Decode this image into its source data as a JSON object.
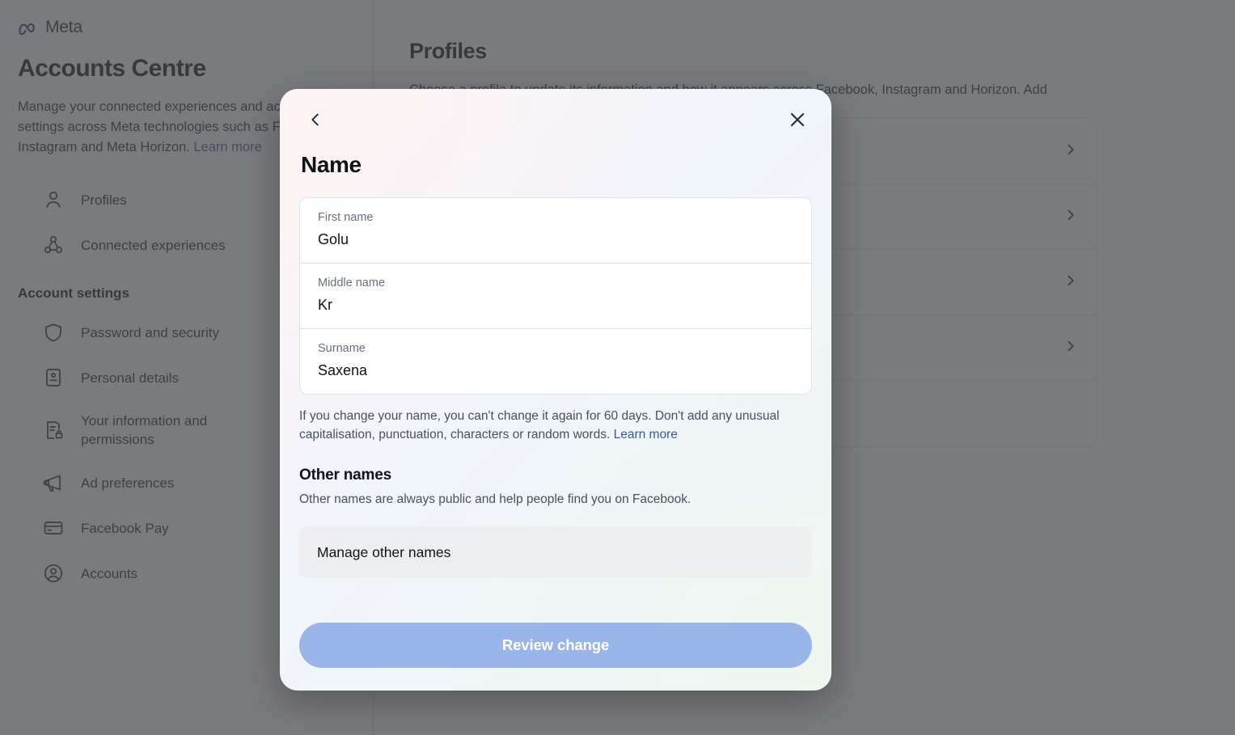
{
  "brand": {
    "name": "Meta",
    "logo_icon": "meta-infinity-icon"
  },
  "sidebar": {
    "title": "Accounts Centre",
    "description": "Manage your connected experiences and account settings across Meta technologies such as Facebook, Instagram and Meta Horizon.",
    "learn_more": "Learn more",
    "primary_items": [
      {
        "label": "Profiles",
        "icon": "person-icon"
      },
      {
        "label": "Connected experiences",
        "icon": "connected-nodes-icon"
      }
    ],
    "group_title": "Account settings",
    "settings_items": [
      {
        "label": "Password and security",
        "icon": "shield-icon"
      },
      {
        "label": "Personal details",
        "icon": "id-card-icon"
      },
      {
        "label": "Your information and permissions",
        "icon": "document-lock-icon"
      },
      {
        "label": "Ad preferences",
        "icon": "megaphone-icon"
      },
      {
        "label": "Facebook Pay",
        "icon": "credit-card-icon"
      },
      {
        "label": "Accounts",
        "icon": "account-circle-icon"
      }
    ]
  },
  "main": {
    "title": "Profiles",
    "description": "Choose a profile to update its information and how it appears across Facebook, Instagram and Horizon. Add",
    "row_count": 5,
    "chevron_icon": "chevron-right-icon"
  },
  "modal": {
    "back_icon": "chevron-left-icon",
    "close_icon": "close-icon",
    "title": "Name",
    "fields": [
      {
        "label": "First name",
        "value": "Golu",
        "placeholder": "First name"
      },
      {
        "label": "Middle name",
        "value": "Kr",
        "placeholder": "Middle name"
      },
      {
        "label": "Surname",
        "value": "Saxena",
        "placeholder": "Surname"
      }
    ],
    "helper_text": "If you change your name, you can't change it again for 60 days. Don't add any unusual capitalisation, punctuation, characters or random words.",
    "helper_link": "Learn more",
    "other_names_title": "Other names",
    "other_names_sub": "Other names are always public and help people find you on Facebook.",
    "manage_other_names": "Manage other names",
    "cta_label": "Review change"
  },
  "colors": {
    "cta_blue": "#9ab5ea",
    "link_blue": "#385898",
    "text_primary": "#101418",
    "text_secondary": "#45515f",
    "overlay": "#5e6063"
  }
}
